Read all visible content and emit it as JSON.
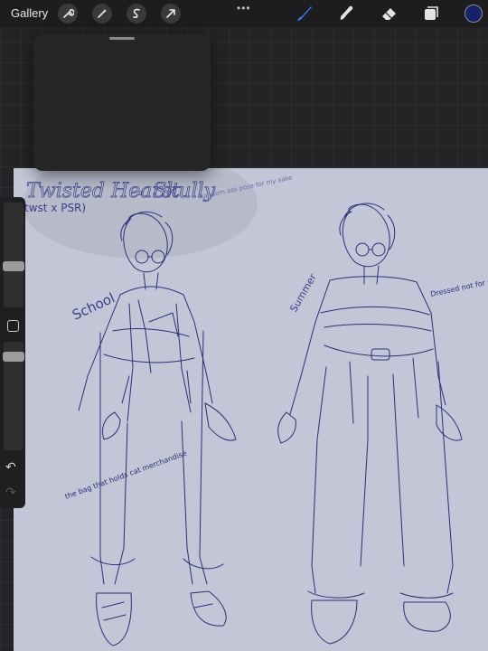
{
  "topbar": {
    "gallery_label": "Gallery",
    "left_tools": [
      "wrench-icon",
      "magic-wand-icon",
      "selection-icon",
      "transform-arrow-icon"
    ],
    "more_label": "•••",
    "right_tools": [
      "brush-icon",
      "smudge-icon",
      "eraser-icon",
      "layers-icon"
    ],
    "active_tool": "brush-icon",
    "color": "#15226a"
  },
  "sidebar": {
    "brush_size": 0.38,
    "opacity": 0.9,
    "undo_label": "↶",
    "redo_label": "↷"
  },
  "canvas": {
    "title": "Twisted Hearst",
    "subtitle_mark": "a",
    "subtitle": "Skully",
    "tag": "twst x PSR)",
    "note_random": "Random ass pose for my sake",
    "label_left": "School",
    "label_right": "Summer",
    "note_summer": "Dressed not for summer just like me fr",
    "note_bag": "the bag that holds cat merchandise",
    "ink_color": "#2a3079",
    "paper_color": "#c2c6d6"
  }
}
